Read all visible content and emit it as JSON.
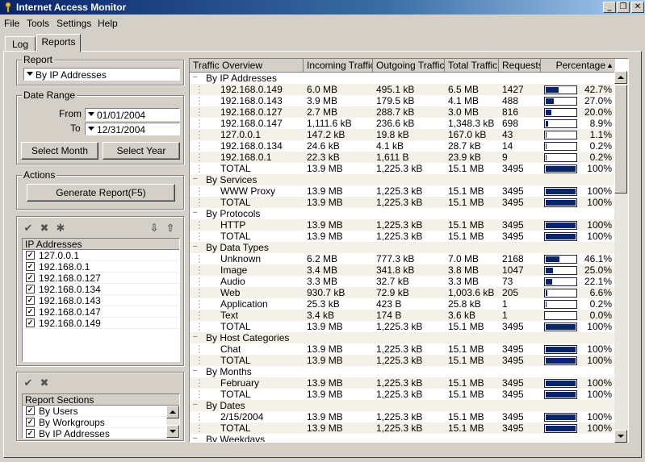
{
  "window": {
    "title": "Internet Access Monitor"
  },
  "menu": [
    "File",
    "Tools",
    "Settings",
    "Help"
  ],
  "tabs": [
    "Log",
    "Reports"
  ],
  "report_group": {
    "label": "Report",
    "selected": "By IP Addresses"
  },
  "date_range": {
    "label": "Date Range",
    "from_label": "From",
    "from_value": "01/01/2004",
    "to_label": "To",
    "to_value": "12/31/2004",
    "select_month": "Select Month",
    "select_year": "Select Year"
  },
  "actions": {
    "label": "Actions",
    "generate": "Generate Report(F5)"
  },
  "ip_list": {
    "header": "IP Addresses",
    "items": [
      "127.0.0.1",
      "192.168.0.1",
      "192.168.0.127",
      "192.168.0.134",
      "192.168.0.143",
      "192.168.0.147",
      "192.168.0.149"
    ]
  },
  "sections_list": {
    "header": "Report Sections",
    "items": [
      "By Users",
      "By Workgroups",
      "By IP Addresses"
    ]
  },
  "grid": {
    "columns": [
      "Traffic Overview",
      "Incoming Traffic",
      "Outgoing Traffic",
      "Total Traffic",
      "Requests",
      "Percentage"
    ],
    "rows": [
      {
        "g": true,
        "name": "By IP Addresses"
      },
      {
        "name": "192.168.0.149",
        "in": "6.0 MB",
        "out": "495.1 kB",
        "total": "6.5 MB",
        "req": "1427",
        "pct": "42.7%",
        "p": 0.427
      },
      {
        "name": "192.168.0.143",
        "in": "3.9 MB",
        "out": "179.5 kB",
        "total": "4.1 MB",
        "req": "488",
        "pct": "27.0%",
        "p": 0.27
      },
      {
        "name": "192.168.0.127",
        "in": "2.7 MB",
        "out": "288.7 kB",
        "total": "3.0 MB",
        "req": "816",
        "pct": "20.0%",
        "p": 0.2
      },
      {
        "name": "192.168.0.147",
        "in": "1,111.6 kB",
        "out": "236.6 kB",
        "total": "1,348.3 kB",
        "req": "698",
        "pct": "8.9%",
        "p": 0.089
      },
      {
        "name": "127.0.0.1",
        "in": "147.2 kB",
        "out": "19.8 kB",
        "total": "167.0 kB",
        "req": "43",
        "pct": "1.1%",
        "p": 0.011
      },
      {
        "name": "192.168.0.134",
        "in": "24.6 kB",
        "out": "4.1 kB",
        "total": "28.7 kB",
        "req": "14",
        "pct": "0.2%",
        "p": 0.002
      },
      {
        "name": "192.168.0.1",
        "in": "22.3 kB",
        "out": "1,611 B",
        "total": "23.9 kB",
        "req": "9",
        "pct": "0.2%",
        "p": 0.002
      },
      {
        "name": "TOTAL",
        "in": "13.9 MB",
        "out": "1,225.3 kB",
        "total": "15.1 MB",
        "req": "3495",
        "pct": "100%",
        "p": 1
      },
      {
        "g": true,
        "name": "By Services"
      },
      {
        "name": "WWW Proxy",
        "in": "13.9 MB",
        "out": "1,225.3 kB",
        "total": "15.1 MB",
        "req": "3495",
        "pct": "100%",
        "p": 1
      },
      {
        "name": "TOTAL",
        "in": "13.9 MB",
        "out": "1,225.3 kB",
        "total": "15.1 MB",
        "req": "3495",
        "pct": "100%",
        "p": 1
      },
      {
        "g": true,
        "name": "By Protocols"
      },
      {
        "name": "HTTP",
        "in": "13.9 MB",
        "out": "1,225.3 kB",
        "total": "15.1 MB",
        "req": "3495",
        "pct": "100%",
        "p": 1
      },
      {
        "name": "TOTAL",
        "in": "13.9 MB",
        "out": "1,225.3 kB",
        "total": "15.1 MB",
        "req": "3495",
        "pct": "100%",
        "p": 1
      },
      {
        "g": true,
        "name": "By Data Types"
      },
      {
        "name": "Unknown",
        "in": "6.2 MB",
        "out": "777.3 kB",
        "total": "7.0 MB",
        "req": "2168",
        "pct": "46.1%",
        "p": 0.461
      },
      {
        "name": "Image",
        "in": "3.4 MB",
        "out": "341.8 kB",
        "total": "3.8 MB",
        "req": "1047",
        "pct": "25.0%",
        "p": 0.25
      },
      {
        "name": "Audio",
        "in": "3.3 MB",
        "out": "32.7 kB",
        "total": "3.3 MB",
        "req": "73",
        "pct": "22.1%",
        "p": 0.221
      },
      {
        "name": "Web",
        "in": "930.7 kB",
        "out": "72.9 kB",
        "total": "1,003.6 kB",
        "req": "205",
        "pct": "6.6%",
        "p": 0.066
      },
      {
        "name": "Application",
        "in": "25.3 kB",
        "out": "423 B",
        "total": "25.8 kB",
        "req": "1",
        "pct": "0.2%",
        "p": 0.002
      },
      {
        "name": "Text",
        "in": "3.4 kB",
        "out": "174 B",
        "total": "3.6 kB",
        "req": "1",
        "pct": "0.0%",
        "p": 0
      },
      {
        "name": "TOTAL",
        "in": "13.9 MB",
        "out": "1,225.3 kB",
        "total": "15.1 MB",
        "req": "3495",
        "pct": "100%",
        "p": 1
      },
      {
        "g": true,
        "name": "By Host Categories"
      },
      {
        "name": "Chat",
        "in": "13.9 MB",
        "out": "1,225.3 kB",
        "total": "15.1 MB",
        "req": "3495",
        "pct": "100%",
        "p": 1
      },
      {
        "name": "TOTAL",
        "in": "13.9 MB",
        "out": "1,225.3 kB",
        "total": "15.1 MB",
        "req": "3495",
        "pct": "100%",
        "p": 1
      },
      {
        "g": true,
        "name": "By Months"
      },
      {
        "name": "February",
        "in": "13.9 MB",
        "out": "1,225.3 kB",
        "total": "15.1 MB",
        "req": "3495",
        "pct": "100%",
        "p": 1
      },
      {
        "name": "TOTAL",
        "in": "13.9 MB",
        "out": "1,225.3 kB",
        "total": "15.1 MB",
        "req": "3495",
        "pct": "100%",
        "p": 1
      },
      {
        "g": true,
        "name": "By Dates"
      },
      {
        "name": "2/15/2004",
        "in": "13.9 MB",
        "out": "1,225.3 kB",
        "total": "15.1 MB",
        "req": "3495",
        "pct": "100%",
        "p": 1
      },
      {
        "name": "TOTAL",
        "in": "13.9 MB",
        "out": "1,225.3 kB",
        "total": "15.1 MB",
        "req": "3495",
        "pct": "100%",
        "p": 1
      },
      {
        "g": true,
        "name": "By Weekdays"
      }
    ]
  }
}
